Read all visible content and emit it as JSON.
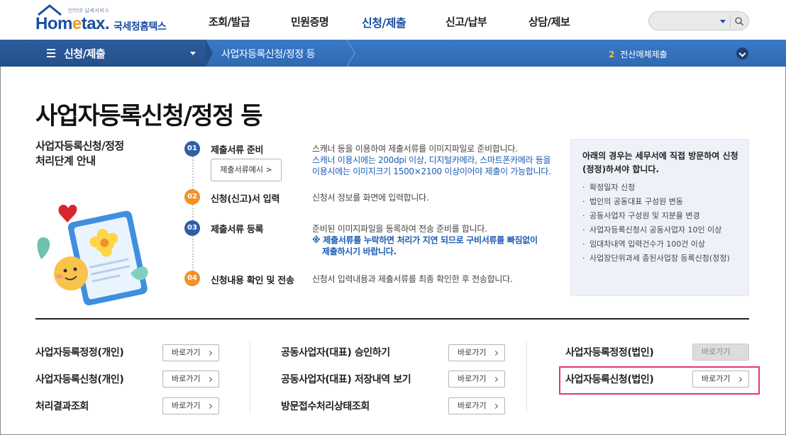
{
  "header": {
    "logo_small": "인터넷 납세서비스",
    "logo_text_h": "Hom",
    "logo_text_e": "e",
    "logo_text_tax": "tax.",
    "logo_korean": "국세청홈택스",
    "menu": [
      "조회/발급",
      "민원증명",
      "신청/제출",
      "신고/납부",
      "상담/제보"
    ]
  },
  "navbar": {
    "section": "신청/제출",
    "crumb": "사업자등록신청/정정 등",
    "notice_num": "2",
    "notice_text": "전산매체제출"
  },
  "page": {
    "title": "사업자등록신청/정정 등",
    "guide_title": "사업자등록신청/정정\n처리단계 안내"
  },
  "steps": [
    {
      "num": "01",
      "label": "제출서류 준비",
      "button": "제출서류예시",
      "desc1": "스캐너 등을 이용하여 제출서류를 이미지파일로 준비합니다.",
      "desc2": "스캐너 이용시에는 200dpi 이상, 디지털카메라, 스마트폰카메라 등을",
      "desc3": "이용시에는 이미지크기 1500×2100 이상이어야 제출이 가능합니다."
    },
    {
      "num": "02",
      "label": "신청(신고)서 입력",
      "desc1": "신청서 정보를 화면에 입력합니다."
    },
    {
      "num": "03",
      "label": "제출서류 등록",
      "desc1": "준비된 이미지파일을 등록하여 전송 준비를 합니다.",
      "desc2": "※ 제출서류를 누락하면 처리가 지연 되므로 구비서류를 빠짐없이",
      "desc3": "제출하시기 바랍니다."
    },
    {
      "num": "04",
      "label": "신청내용 확인 및 전송",
      "desc1": "신청서 입력내용과 제출서류를 최종 확인한 후 전송합니다."
    }
  ],
  "info_box": {
    "head": "아래의 경우는 세무서에 직접 방문하여 신청(정정)하셔야 합니다.",
    "items": [
      "확정일자 신청",
      "법인의 공동대표 구성원 변동",
      "공동사업자 구성원 및 지분율 변경",
      "사업자등록신청시 공동사업자 10인 이상",
      "임대차내역 입력건수가 100건 이상",
      "사업장단위과세 종된사업장 등록신청(정정)"
    ]
  },
  "links": {
    "go_label": "바로가기",
    "col1": [
      "사업자등록정정(개인)",
      "사업자등록신청(개인)",
      "처리결과조회"
    ],
    "col2": [
      "공동사업자(대표) 승인하기",
      "공동사업자(대표) 저장내역 보기",
      "방문접수처리상태조회"
    ],
    "col3": [
      "사업자등록정정(법인)",
      "사업자등록신청(법인)"
    ]
  },
  "colors": {
    "brand_blue": "#1a4ea0",
    "nav_blue": "#3b7ac7",
    "highlight": "#e33b6a",
    "orange": "#f1912a"
  }
}
